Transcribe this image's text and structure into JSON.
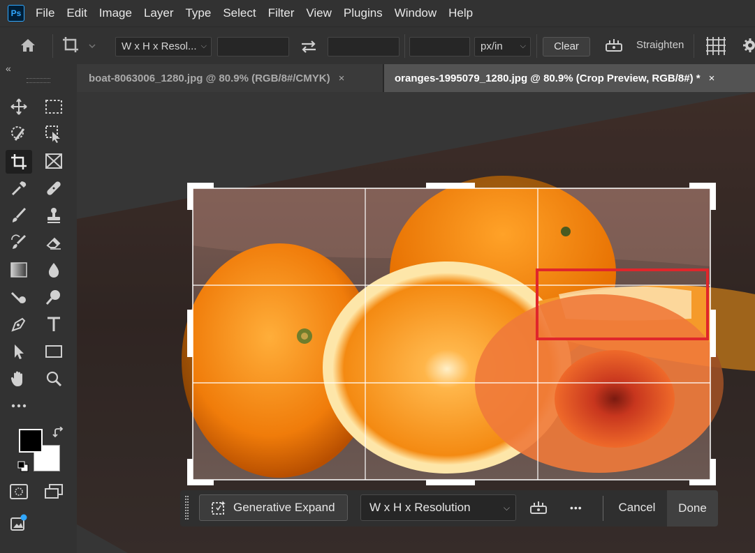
{
  "menubar": {
    "logo": "Ps",
    "items": [
      "File",
      "Edit",
      "Image",
      "Layer",
      "Type",
      "Select",
      "Filter",
      "View",
      "Plugins",
      "Window",
      "Help"
    ]
  },
  "options": {
    "ratio_label": "W x H x Resol...",
    "width_value": "",
    "height_value": "",
    "resolution_value": "",
    "unit": "px/in",
    "clear_label": "Clear",
    "straighten_label": "Straighten"
  },
  "tabs": [
    {
      "label": "boat-8063006_1280.jpg @ 80.9% (RGB/8#/CMYK)",
      "close": "×"
    },
    {
      "label": "oranges-1995079_1280.jpg @ 80.9% (Crop Preview, RGB/8#) *",
      "close": "×"
    }
  ],
  "toolbar": {
    "collapse": "«"
  },
  "taskbar": {
    "generative_expand": "Generative Expand",
    "ratio": "W x H x Resolution",
    "more": "•••",
    "cancel": "Cancel",
    "done": "Done"
  },
  "colors": {
    "accent": "#31a8ff",
    "highlight_box": "#e0262b",
    "foreground": "#000000",
    "background": "#ffffff"
  }
}
